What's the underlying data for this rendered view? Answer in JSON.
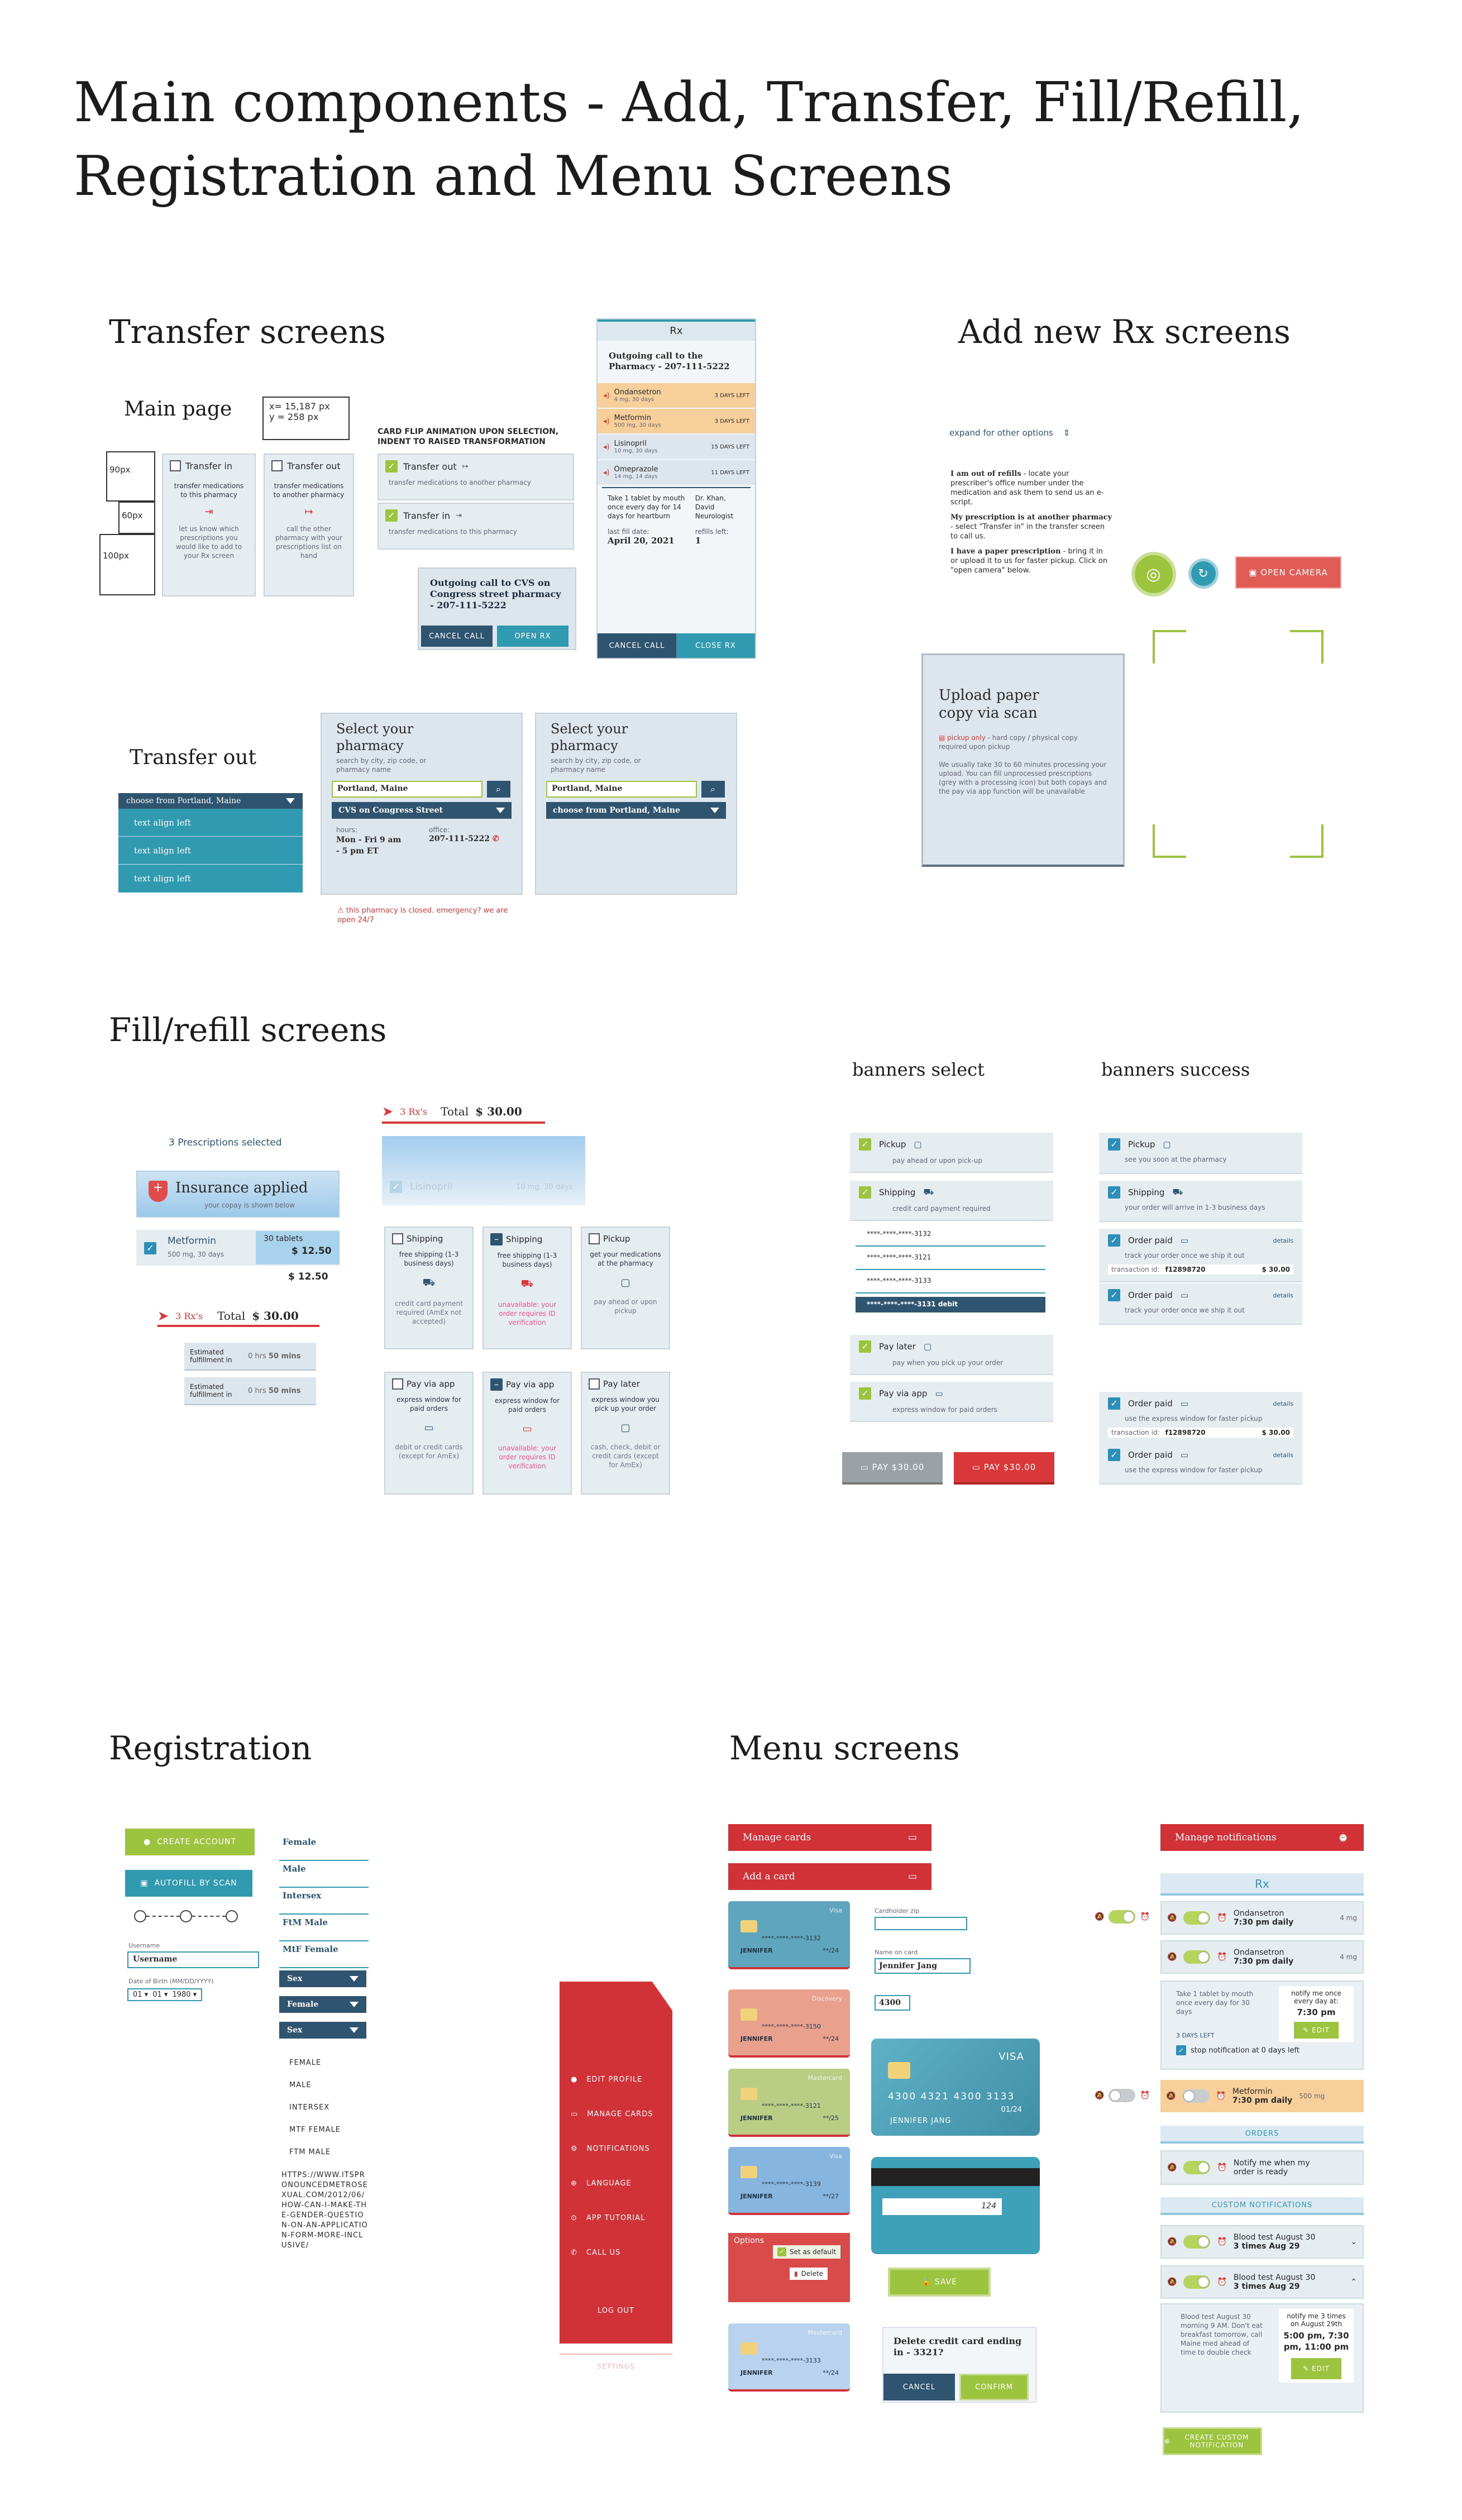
{
  "title_line1": "Main components - Add, Transfer, Fill/Refill,",
  "title_line2": "Registration and Menu Screens",
  "sections": {
    "transfer": "Transfer screens",
    "add_rx": "Add new Rx screens",
    "fill": "Fill/refill screens",
    "registration": "Registration",
    "menu": "Menu screens"
  },
  "transfer": {
    "main_page": "Main page",
    "coords_line1": "x= 15,187 px",
    "coords_line2": "y = 258 px",
    "dim_90": "90px",
    "dim_60": "60px",
    "dim_100": "100px",
    "tin_title": "Transfer in",
    "tin_desc": "transfer medications to this pharmacy",
    "tin_body": "let us know which prescriptions you would like to add to your Rx screen",
    "tout_title": "Transfer out",
    "tout_desc": "transfer medications to another pharmacy",
    "tout_body": "call the other pharmacy with your prescriptions list on hand",
    "flip_note": "CARD FLIP ANIMATION UPON SELECTION, INDENT TO RAISED TRANSFORMATION",
    "flip_out_title": "Transfer out",
    "flip_out_desc": "transfer medications to another pharmacy",
    "flip_in_title": "Transfer in",
    "flip_in_desc": "transfer medications to this pharmacy",
    "call_title": "Outgoing call to CVS on Congress street pharmacy - 207-111-5222",
    "cancel_call": "CANCEL CALL",
    "open_rx": "OPEN RX",
    "rx_header": "Rx",
    "rx_call": "Outgoing call to the Pharmacy - 207-111-5222",
    "rx_items": [
      {
        "name": "Ondansetron",
        "sub": "4 mg, 30 days",
        "days": "3 DAYS LEFT"
      },
      {
        "name": "Metformin",
        "sub": "500 mg, 30 days",
        "days": "3 DAYS LEFT"
      },
      {
        "name": "Lisinopril",
        "sub": "10 mg, 30 days",
        "days": "15 DAYS LEFT"
      },
      {
        "name": "Omeprazole",
        "sub": "14 mg, 14 days",
        "days": "11 DAYS LEFT"
      }
    ],
    "rx_detail": "Take 1 tablet by mouth once every day for 14 days for heartburn",
    "rx_doctor": "Dr. Khan, David Neurologist",
    "rx_last_fill_label": "last fill date:",
    "rx_last_fill": "April 20, 2021",
    "rx_refills_label": "refills left:",
    "rx_refills": "1",
    "close_rx": "CLOSE RX",
    "transfer_out": "Transfer out",
    "choose_from": "choose from Portland, Maine",
    "align1": "text align left",
    "align2": "text align left",
    "align3": "text align left",
    "select_title": "Select your pharmacy",
    "select_sub": "search by city, zip code, or pharmacy name",
    "search_value": "Portland, Maine",
    "result": "CVS on Congress Street",
    "hours_label": "hours:",
    "hours": "Mon - Fri 9 am - 5 pm ET",
    "office_label": "office:",
    "office": "207-111-5222",
    "closed_note": "this pharmacy is closed. emergency? we are open 24/7",
    "select2_title": "Select your pharmacy",
    "select2_sub": "search by city, zip code, or pharmacy name",
    "search2_value": "Portland, Maine",
    "choose_from2": "choose from Portland, Maine"
  },
  "add": {
    "expand": "expand for other options",
    "out_head": "I am out of refills",
    "out_text": "- locate your prescriber's office number under the medication and ask them to send us an e-script.",
    "another_head": "My prescription is at another pharmacy",
    "another_text": "- select \"Transfer in\" in the transfer screen to call us.",
    "paper_head": "I have a paper prescription",
    "paper_text": "- bring it in or upload it to us for faster pickup. Click on \"open camera\" below.",
    "open_camera": "OPEN CAMERA",
    "upload_title": "Upload paper copy via scan",
    "pickup_only": "pickup only",
    "pickup_note": "- hard copy / physical copy required upon pickup",
    "upload_body": "We usually take 30 to 60 minutes processing your upload. You can fill unprocessed prescriptions (grey with a processing icon) but both copays and the pay via app function will be unavailable"
  },
  "fill": {
    "prescriptions_selected": "3 Prescriptions selected",
    "insurance": "Insurance applied",
    "insurance_sub": "your copay is shown below",
    "med": "Metformin",
    "med_sub": "500 mg, 30 days",
    "tablets": "30 tablets",
    "price1": "$ 12.50",
    "price2": "$ 12.50",
    "rx_count": "3 Rx's",
    "total_label": "Total",
    "total": "$ 30.00",
    "est1": "Estimated fulfillment in",
    "est_hrs": "0 hrs",
    "est_mins": "50 mins",
    "est2": "Estimated fulfillment in",
    "rx_count2": "3 Rx's",
    "total_label2": "Total",
    "total2": "$ 30.00",
    "lisinopril": "Lisinopril",
    "lis_sub": "10 mg, 30 days",
    "opts": [
      {
        "title": "Shipping",
        "desc": "free shipping (1-3 business days)",
        "body": "credit card payment required (AmEx not accepted)"
      },
      {
        "title": "Shipping",
        "desc": "free shipping (1-3 business days)",
        "body": "unavailable: your order requires ID verification"
      },
      {
        "title": "Pickup",
        "desc": "get your medications at the pharmacy",
        "body": "pay ahead or upon pickup"
      },
      {
        "title": "Pay via app",
        "desc": "express window for paid orders",
        "body": "debit or credit cards (except for AmEx)"
      },
      {
        "title": "Pay via app",
        "desc": "express window for paid orders",
        "body": "unavailable: your order requires ID verification"
      },
      {
        "title": "Pay later",
        "desc": "express window you pick up your order",
        "body": "cash, check, debit or credit cards (except for AmEx)"
      }
    ],
    "banners_select": "banners select",
    "banners_success": "banners success",
    "sel": [
      {
        "title": "Pickup",
        "desc": "pay ahead or upon pick-up"
      },
      {
        "title": "Shipping",
        "desc": "credit card payment required"
      }
    ],
    "cards": [
      "****-****-****-3132",
      "****-****-****-3121",
      "****-****-****-3133",
      "****-****-****-3131 debit"
    ],
    "sel2": [
      {
        "title": "Pay later",
        "desc": "pay when you pick up your order"
      },
      {
        "title": "Pay via app",
        "desc": "express window for paid orders"
      }
    ],
    "pay1": "PAY $30.00",
    "pay2": "PAY $30.00",
    "succ": [
      {
        "title": "Pickup",
        "desc": "see you soon at the pharmacy"
      },
      {
        "title": "Shipping",
        "desc": "your order will arrive in 1-3 business days"
      },
      {
        "title": "Order paid",
        "desc": "track your order once we ship it out",
        "details": "details",
        "txn_label": "transaction id:",
        "txn": "f12898720",
        "amt": "$ 30.00"
      },
      {
        "title": "Order paid",
        "desc": "track your order once we ship it out",
        "details": "details"
      },
      {
        "title": "Order paid",
        "desc": "use the express window for faster pickup",
        "details": "details",
        "txn_label": "transaction id:",
        "txn": "f12898720",
        "amt": "$ 30.00"
      },
      {
        "title": "Order paid",
        "desc": "use the express window for faster pickup",
        "details": "details"
      }
    ]
  },
  "reg": {
    "create": "CREATE ACCOUNT",
    "autofill": "AUTOFILL BY SCAN",
    "username_label": "Username",
    "username": "Username",
    "dob_label": "Date of Birth (MM/DD/YYYY)",
    "mm": "01",
    "dd": "01",
    "yyyy": "1980",
    "sex_opts": [
      "Female",
      "Male",
      "Intersex",
      "FtM Male",
      "MtF Female"
    ],
    "sex1": "Sex",
    "sex2": "Female",
    "sex3": "Sex",
    "upper_opts": [
      "FEMALE",
      "MALE",
      "INTERSEX",
      "MTF FEMALE",
      "FTM MALE"
    ],
    "url": "HTTPS://WWW.ITSPRONOUNCEDMETROSEXUAL.COM/2012/06/HOW-CAN-I-MAKE-THE-GENDER-QUESTION-ON-AN-APPLICATION-FORM-MORE-INCLUSIVE/"
  },
  "menu": {
    "items": [
      "EDIT PROFILE",
      "MANAGE CARDS",
      "NOTIFICATIONS",
      "LANGUAGE",
      "APP TUTORIAL",
      "CALL US"
    ],
    "logout": "LOG OUT",
    "settings": "SETTINGS",
    "manage_cards": "Manage cards",
    "add_card": "Add a card",
    "cc": [
      {
        "brand": "Visa",
        "num": "****-****-****-3132",
        "name": "JENNIFER",
        "exp": "**/24",
        "color": "#5fa5bd"
      },
      {
        "brand": "Discovery",
        "num": "****-****-****-3150",
        "name": "JENNIFER",
        "exp": "**/24",
        "color": "#e9a08c"
      },
      {
        "brand": "Mastercard",
        "num": "****-****-****-3121",
        "name": "JENNIFER",
        "exp": "**/25",
        "color": "#b9cd84"
      },
      {
        "brand": "Visa",
        "num": "****-****-****-3139",
        "name": "JENNIFER",
        "exp": "**/27",
        "color": "#86b5df"
      },
      {
        "brand": "Mastercard",
        "num": "****-****-****-3133",
        "name": "JENNIFER",
        "exp": "**/24",
        "color": "#b9d3ef"
      }
    ],
    "options": "Options",
    "default": "Set as default",
    "delete": "Delete",
    "cardholder_label": "Cardholder zip",
    "name_label": "Name on card",
    "name_val": "Jennifer Jang",
    "zip_val": "4300",
    "big_brand": "VISA",
    "big_num": "4300  4321  4300  3133",
    "big_exp": "01/24",
    "big_name": "JENNIFER JANG",
    "cvv": "124",
    "save": "SAVE",
    "delete_q": "Delete credit card ending in - 3321?",
    "cancel": "CANCEL",
    "confirm": "CONFIRM",
    "manage_notif": "Manage notifications",
    "rx": "Rx",
    "n_items": [
      {
        "name": "Ondansetron",
        "dose": "4 mg",
        "time": "7:30 pm daily"
      },
      {
        "name": "Ondansetron",
        "dose": "4 mg",
        "time": "7:30 pm daily"
      }
    ],
    "n_detail": "Take 1 tablet by mouth once every day for 30 days",
    "n_notify": "notify me once every day at:",
    "n_time": "7:30 pm",
    "edit": "EDIT",
    "n_days": "3 DAYS LEFT",
    "n_stop": "stop notification at 0 days left",
    "metformin": "Metformin",
    "met_dose": "500 mg",
    "met_time": "7:30 pm daily",
    "orders": "ORDERS",
    "notify_ready": "Notify me when my order is ready",
    "custom": "CUSTOM NOTIFICATIONS",
    "blood1": "Blood test August 30",
    "blood1_time": "3 times Aug 29",
    "blood2": "Blood test August 30",
    "blood2_time": "3 times Aug 29",
    "blood_detail": "Blood test August 30 morning 9 AM. Don't eat breakfast tomorrow, call Maine med ahead of time to double check",
    "blood_notify": "notify me 3 times on August 29th",
    "blood_times": "5:00 pm, 7:30 pm, 11:00 pm",
    "create_custom": "CREATE CUSTOM NOTIFICATION"
  }
}
